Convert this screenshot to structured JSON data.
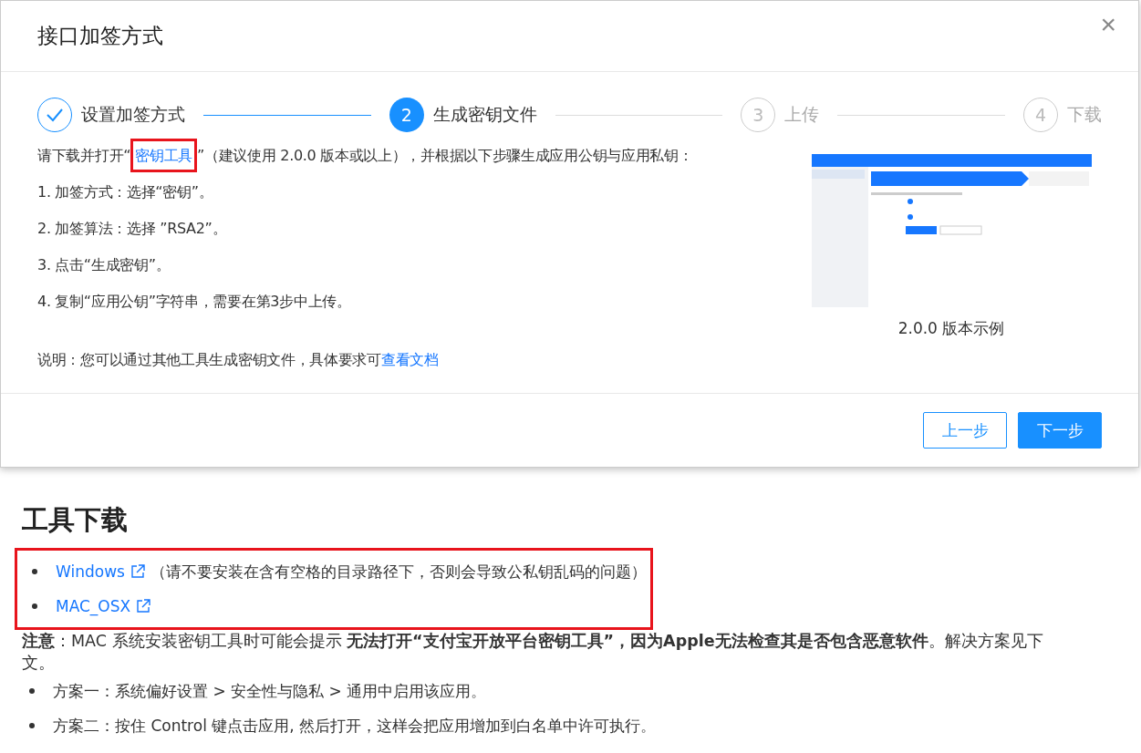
{
  "dialog": {
    "title": "接口加签方式",
    "close": "×",
    "steps": [
      {
        "label": "设置加签方式",
        "done": true,
        "current": false
      },
      {
        "number": "2",
        "label": "生成密钥文件",
        "done": false,
        "current": true
      },
      {
        "number": "3",
        "label": "上传",
        "done": false,
        "current": false
      },
      {
        "number": "4",
        "label": "下载",
        "done": false,
        "current": false
      }
    ],
    "intro": {
      "before": "请下载并打开“",
      "link": "密钥工具",
      "after": "”（建议使用 2.0.0 版本或以上），并根据以下步骤生成应用公钥与应用私钥：",
      "highlighted": true
    },
    "instructions": [
      "1. 加签方式：选择“密钥”。",
      "2. 加签算法：选择 ”RSA2”。",
      "3. 点击“生成密钥”。",
      "4. 复制“应用公钥”字符串，需要在第3步中上传。"
    ],
    "note": {
      "text": "说明：您可以通过其他工具生成密钥文件，具体要求可",
      "link": "查看文档"
    },
    "preview": {
      "kind": "picture",
      "caption": "2.0.0 版本示例"
    },
    "buttons": [
      {
        "label": "上一步",
        "kind": "secondary"
      },
      {
        "label": "下一步",
        "kind": "primary"
      }
    ]
  },
  "page": {
    "heading": "工具下载",
    "downloads_highlighted": true,
    "downloads": [
      {
        "link": "Windows",
        "note": "（请不要安装在含有空格的目录路径下，否则会导致公私钥乱码的问题）"
      },
      {
        "link": "MAC_OSX"
      }
    ],
    "warning": "**注意**：MAC 系统安装密钥工具时可能会提示 **无法打开“支付宝开放平台密钥工具”，因为Apple无法检查其是否包含恶意软件**。解决方案见下文。",
    "solutions": [
      "方案一：系统偏好设置 > 安全性与隐私 > 通用中启用该应用。",
      "方案二：按住 Control 键点击应用, 然后打开，这样会把应用增加到白名单中许可执行。"
    ]
  }
}
